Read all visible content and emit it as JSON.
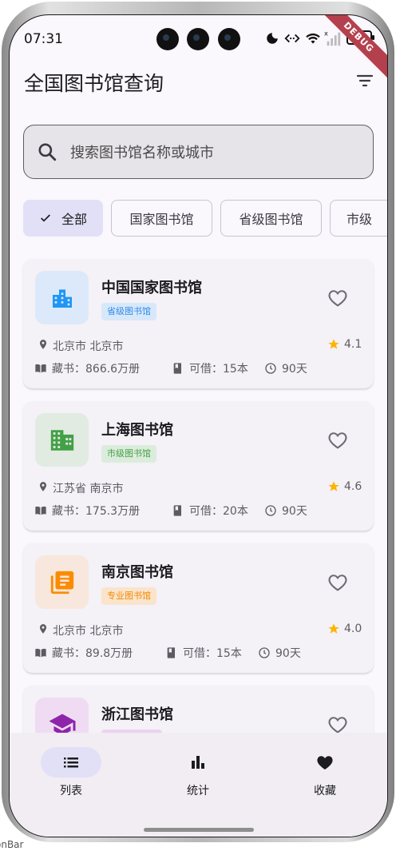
{
  "status_bar": {
    "time": "07:31",
    "battery": "100",
    "debug_label": "DEBUG",
    "icons": [
      "moon-icon",
      "nfc-icon",
      "wifi-icon",
      "signal-icon",
      "battery-icon"
    ]
  },
  "app_bar": {
    "title": "全国图书馆查询",
    "action_icon": "filter-icon"
  },
  "search": {
    "placeholder": "搜索图书馆名称或城市",
    "icon": "search-icon"
  },
  "filters": [
    {
      "label": "全部",
      "selected": true
    },
    {
      "label": "国家图书馆",
      "selected": false
    },
    {
      "label": "省级图书馆",
      "selected": false
    },
    {
      "label": "市级",
      "selected": false
    }
  ],
  "libraries": [
    {
      "name": "中国国家图书馆",
      "tag": "省级图书馆",
      "icon": "city-building-icon",
      "icon_color": "#2196f3",
      "icon_bg": "#dce9fb",
      "tag_bg": "#d8e8fb",
      "tag_color": "#2f8be6",
      "location": "北京市 北京市",
      "rating": "4.1",
      "collection": "藏书：866.6万册",
      "borrow": "可借：15本",
      "period": "90天"
    },
    {
      "name": "上海图书馆",
      "tag": "市级图书馆",
      "icon": "apartment-icon",
      "icon_color": "#43a047",
      "icon_bg": "#e1ebe2",
      "tag_bg": "#dcecdc",
      "tag_color": "#43a047",
      "location": "江苏省 南京市",
      "rating": "4.6",
      "collection": "藏书：175.3万册",
      "borrow": "可借：20本",
      "period": "90天"
    },
    {
      "name": "南京图书馆",
      "tag": "专业图书馆",
      "icon": "books-icon",
      "icon_color": "#fb8c00",
      "icon_bg": "#f8e7dc",
      "tag_bg": "#fae4cc",
      "tag_color": "#f08a00",
      "location": "北京市 北京市",
      "rating": "4.0",
      "collection": "藏书：89.8万册",
      "borrow": "可借：15本",
      "period": "90天"
    },
    {
      "name": "浙江图书馆",
      "tag": "",
      "icon": "graduation-cap-icon",
      "icon_color": "#8e24aa",
      "icon_bg": "#efdcf3",
      "tag_bg": "#ead3f0",
      "tag_color": "#8e24aa"
    }
  ],
  "bottom_nav": [
    {
      "label": "列表",
      "icon": "list-icon",
      "active": true
    },
    {
      "label": "统计",
      "icon": "bar-chart-icon",
      "active": false
    },
    {
      "label": "收藏",
      "icon": "heart-icon",
      "active": false
    }
  ],
  "colors": {
    "accent": "#e2e0f6",
    "background": "#faf7fd",
    "star": "#ffb300"
  },
  "outside_caption": "onBar"
}
